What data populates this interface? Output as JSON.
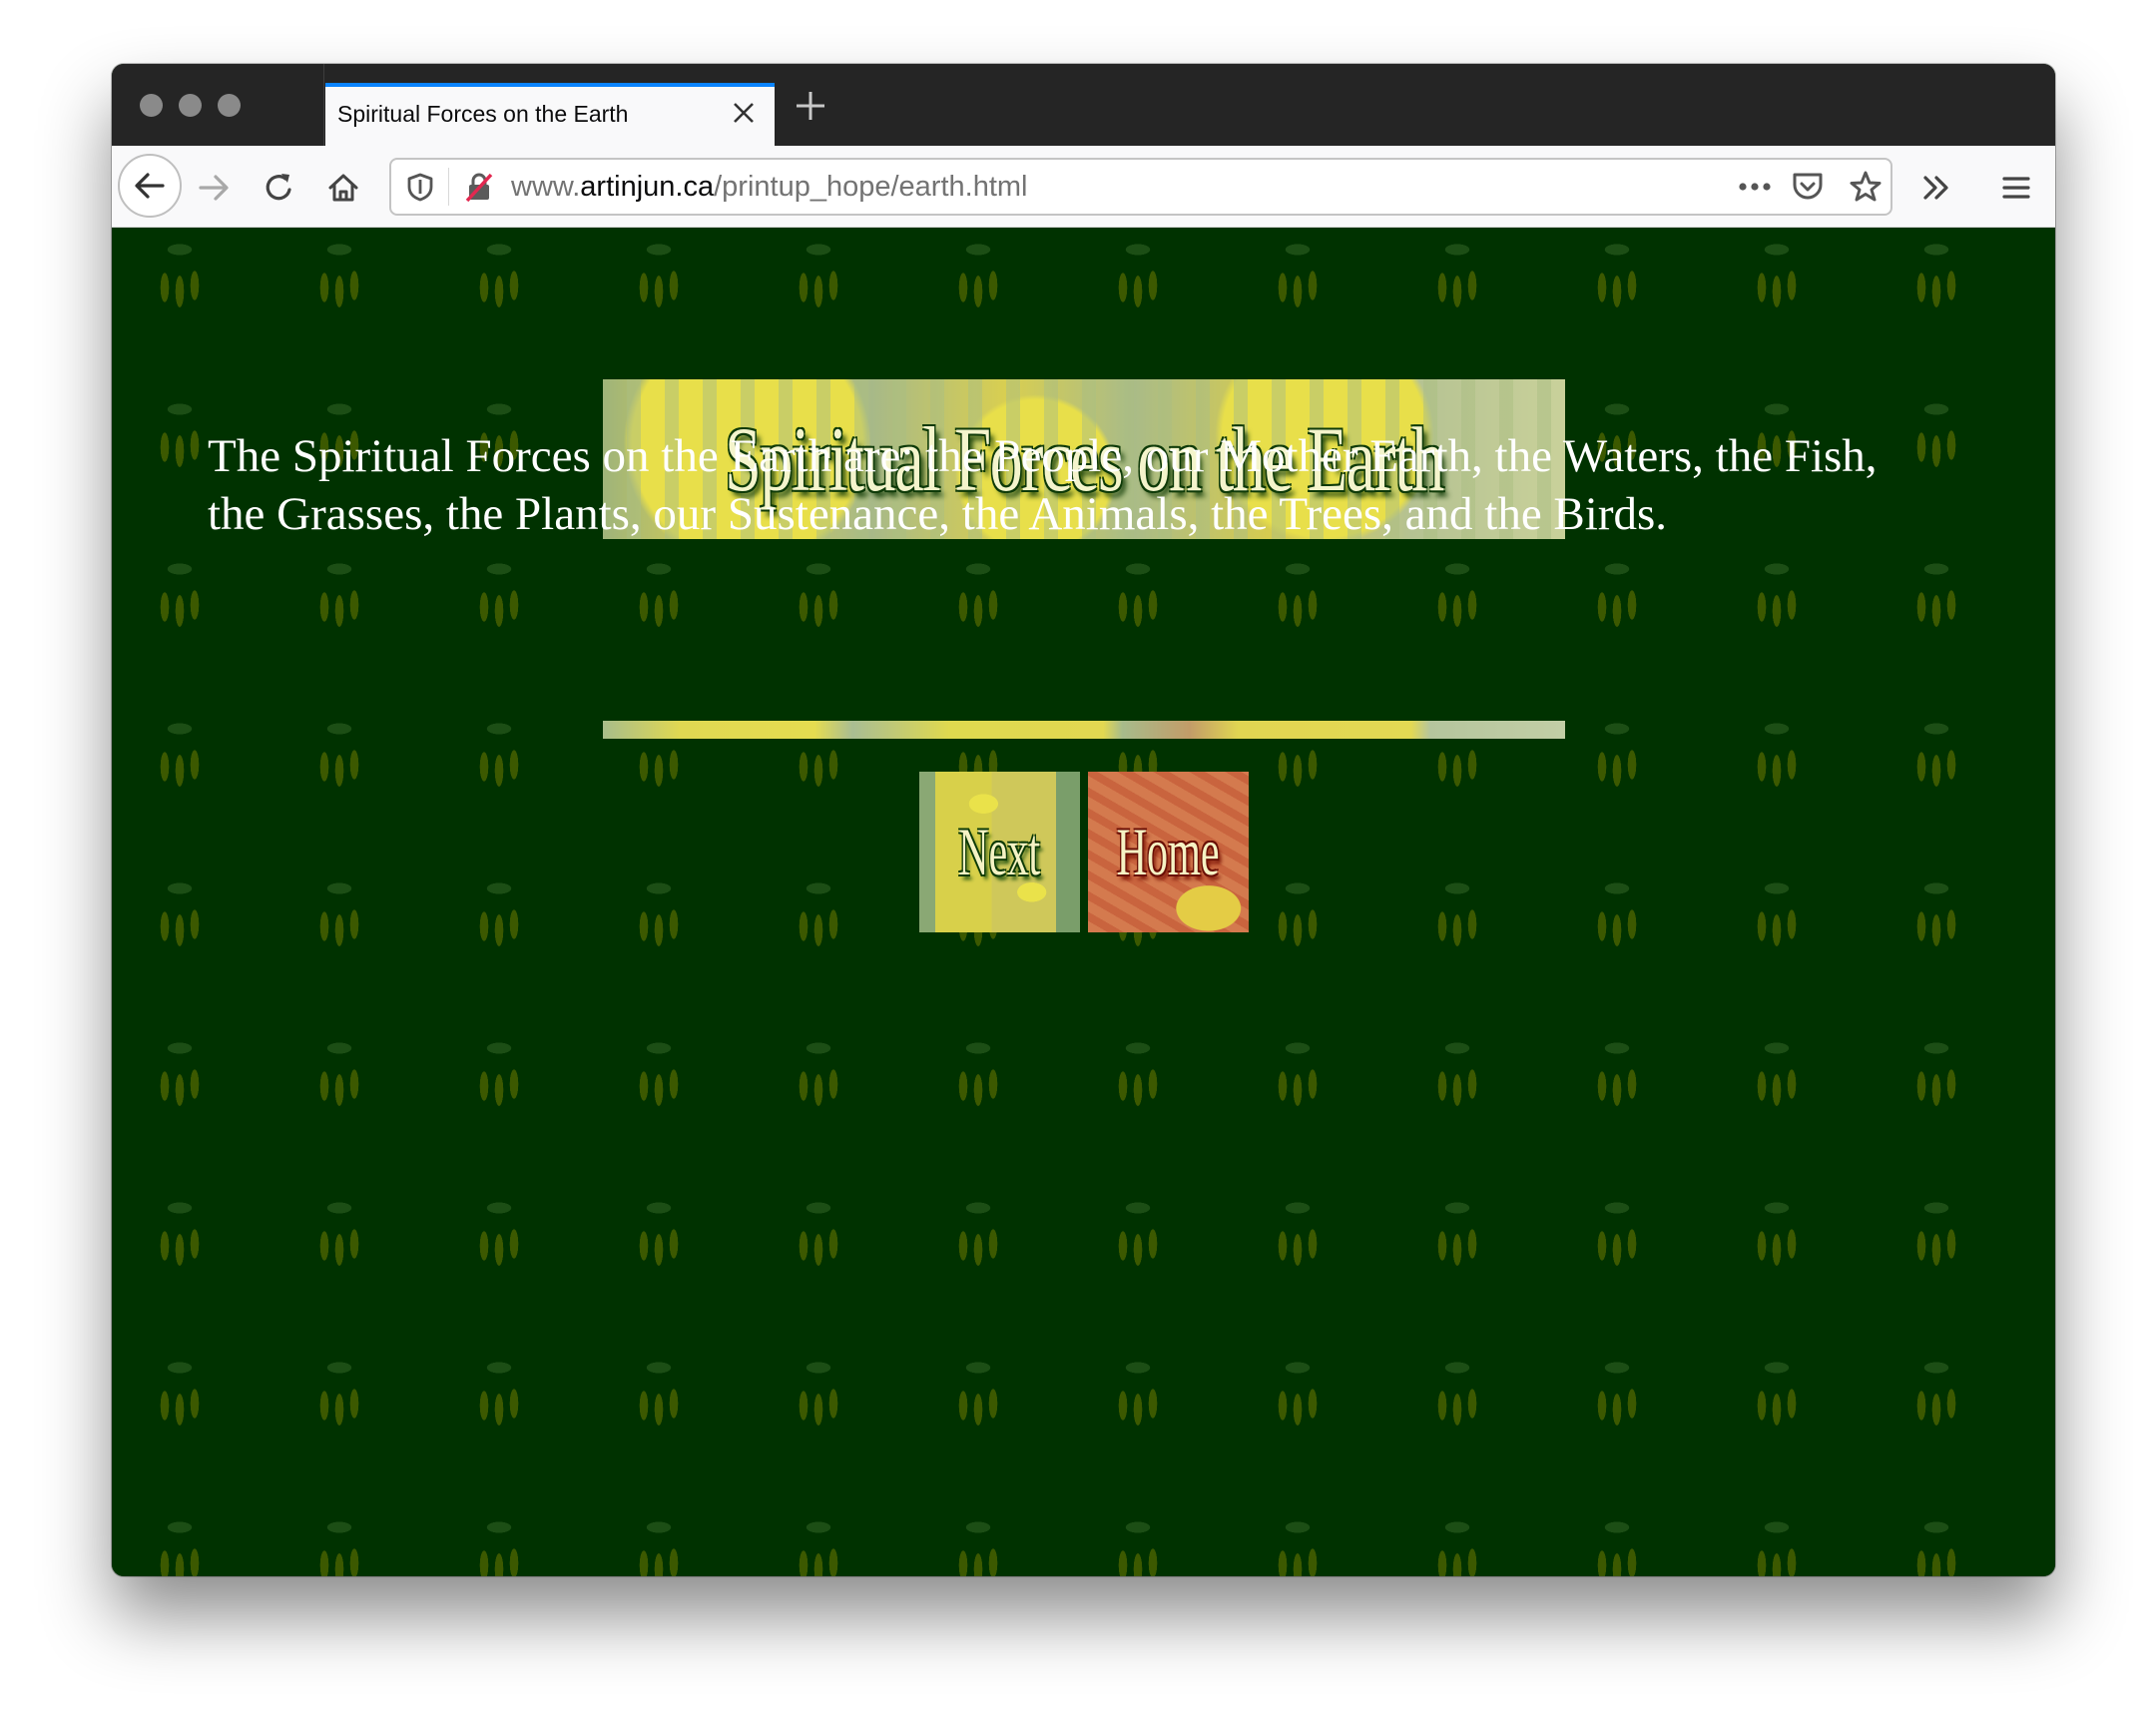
{
  "browser": {
    "tab": {
      "title": "Spiritual Forces on the Earth",
      "close_icon": "close-icon"
    },
    "new_tab_icon": "plus-icon",
    "toolbar": {
      "back_icon": "arrow-left-icon",
      "forward_icon": "arrow-right-icon",
      "reload_icon": "reload-icon",
      "home_icon": "home-icon",
      "tracking_protection_icon": "shield-icon",
      "insecure_icon": "lock-strikethrough-icon",
      "url": {
        "prefix": "www.",
        "domain": "artinjun.ca",
        "path": "/printup_hope/earth.html"
      },
      "page_actions_icon": "more-dots-icon",
      "pocket_icon": "pocket-icon",
      "bookmark_icon": "star-icon",
      "overflow_icon": "chevron-double-right-icon",
      "menu_icon": "hamburger-menu-icon"
    }
  },
  "page": {
    "background_color": "#003200",
    "banner_title": "Spiritual Forces on the Earth",
    "body_text": "The Spiritual Forces on the Earth are: the People, our Mother Earth, the Waters, the Fish, the Grasses, the Plants, our Sustenance, the Animals, the Trees, and the Birds.",
    "nav": {
      "next_label": "Next",
      "home_label": "Home"
    }
  }
}
